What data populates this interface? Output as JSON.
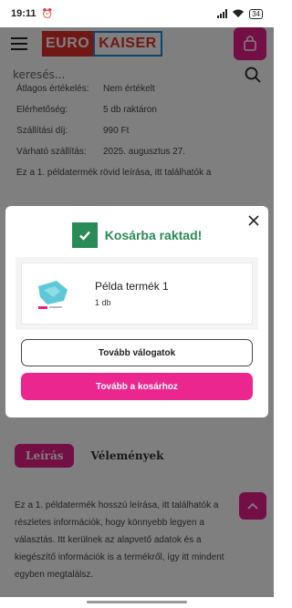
{
  "status_bar": {
    "time": "19:11",
    "battery": "34"
  },
  "header": {
    "logo_left": "EURO",
    "logo_right": "KAISER"
  },
  "search": {
    "placeholder": "keresés..."
  },
  "details": {
    "rows": [
      {
        "label": "Átlagos értékelés:",
        "value": "Nem értékelt"
      },
      {
        "label": "Elérhetőség:",
        "value": "5 db raktáron"
      },
      {
        "label": "Szállítási díj:",
        "value": "990 Ft"
      },
      {
        "label": "Várható szállítás:",
        "value": "2025. augusztus 27."
      }
    ],
    "short_description": "Ez a 1. példatermék rövid leírása, itt találhatók a"
  },
  "tabs": {
    "description": "Leírás",
    "reviews": "Vélemények"
  },
  "long_description": "Ez a 1. példatermék hosszú leírása, itt találhatók a részletes információk, hogy könnyebb legyen a választás. Itt kerülnek az alapvető adatok és a kiegészítő információk is a termékről, így itt mindent egyben megtalálsz.",
  "modal": {
    "title": "Kosárba raktad!",
    "product_name": "Példa termék 1",
    "product_qty": "1 db",
    "continue_label": "Tovább válogatok",
    "cart_label": "Tovább a kosárhoz"
  },
  "colors": {
    "accent": "#e91e8c",
    "success": "#2a8a58"
  }
}
